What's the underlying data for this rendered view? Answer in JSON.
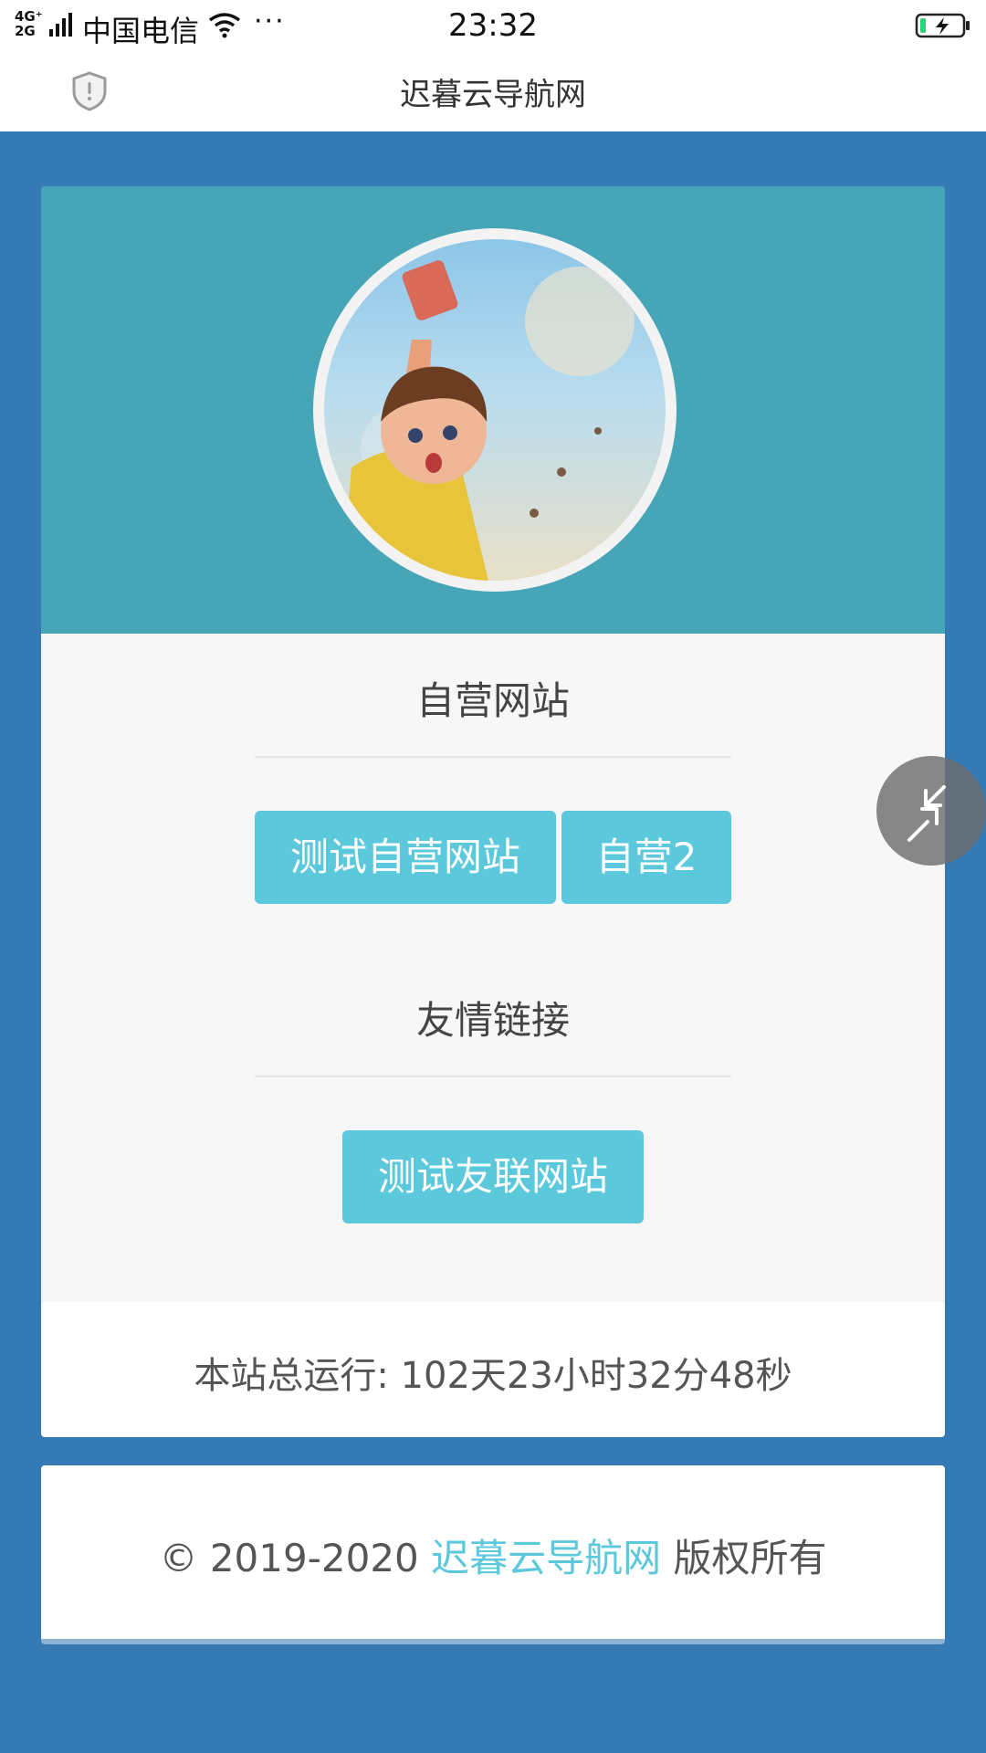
{
  "status_bar": {
    "network": "4G⁺\n2G",
    "carrier": "中国电信",
    "more": "···",
    "time": "23:32"
  },
  "header": {
    "title": "迟暮云导航网"
  },
  "sections": [
    {
      "title": "自营网站",
      "links": [
        "测试自营网站",
        "自营2"
      ]
    },
    {
      "title": "友情链接",
      "links": [
        "测试友联网站"
      ]
    }
  ],
  "runtime": "本站总运行: 102天23小时32分48秒",
  "copyright": {
    "prefix": "© 2019-2020",
    "site": "迟暮云导航网",
    "suffix": "版权所有"
  },
  "colors": {
    "page_bg": "#3579b5",
    "header_bg": "#46a6b8",
    "button": "#5bc8dc",
    "link": "#5bc8dc"
  },
  "icons": {
    "shield": "shield-icon",
    "float": "shrink-arrows-icon"
  }
}
